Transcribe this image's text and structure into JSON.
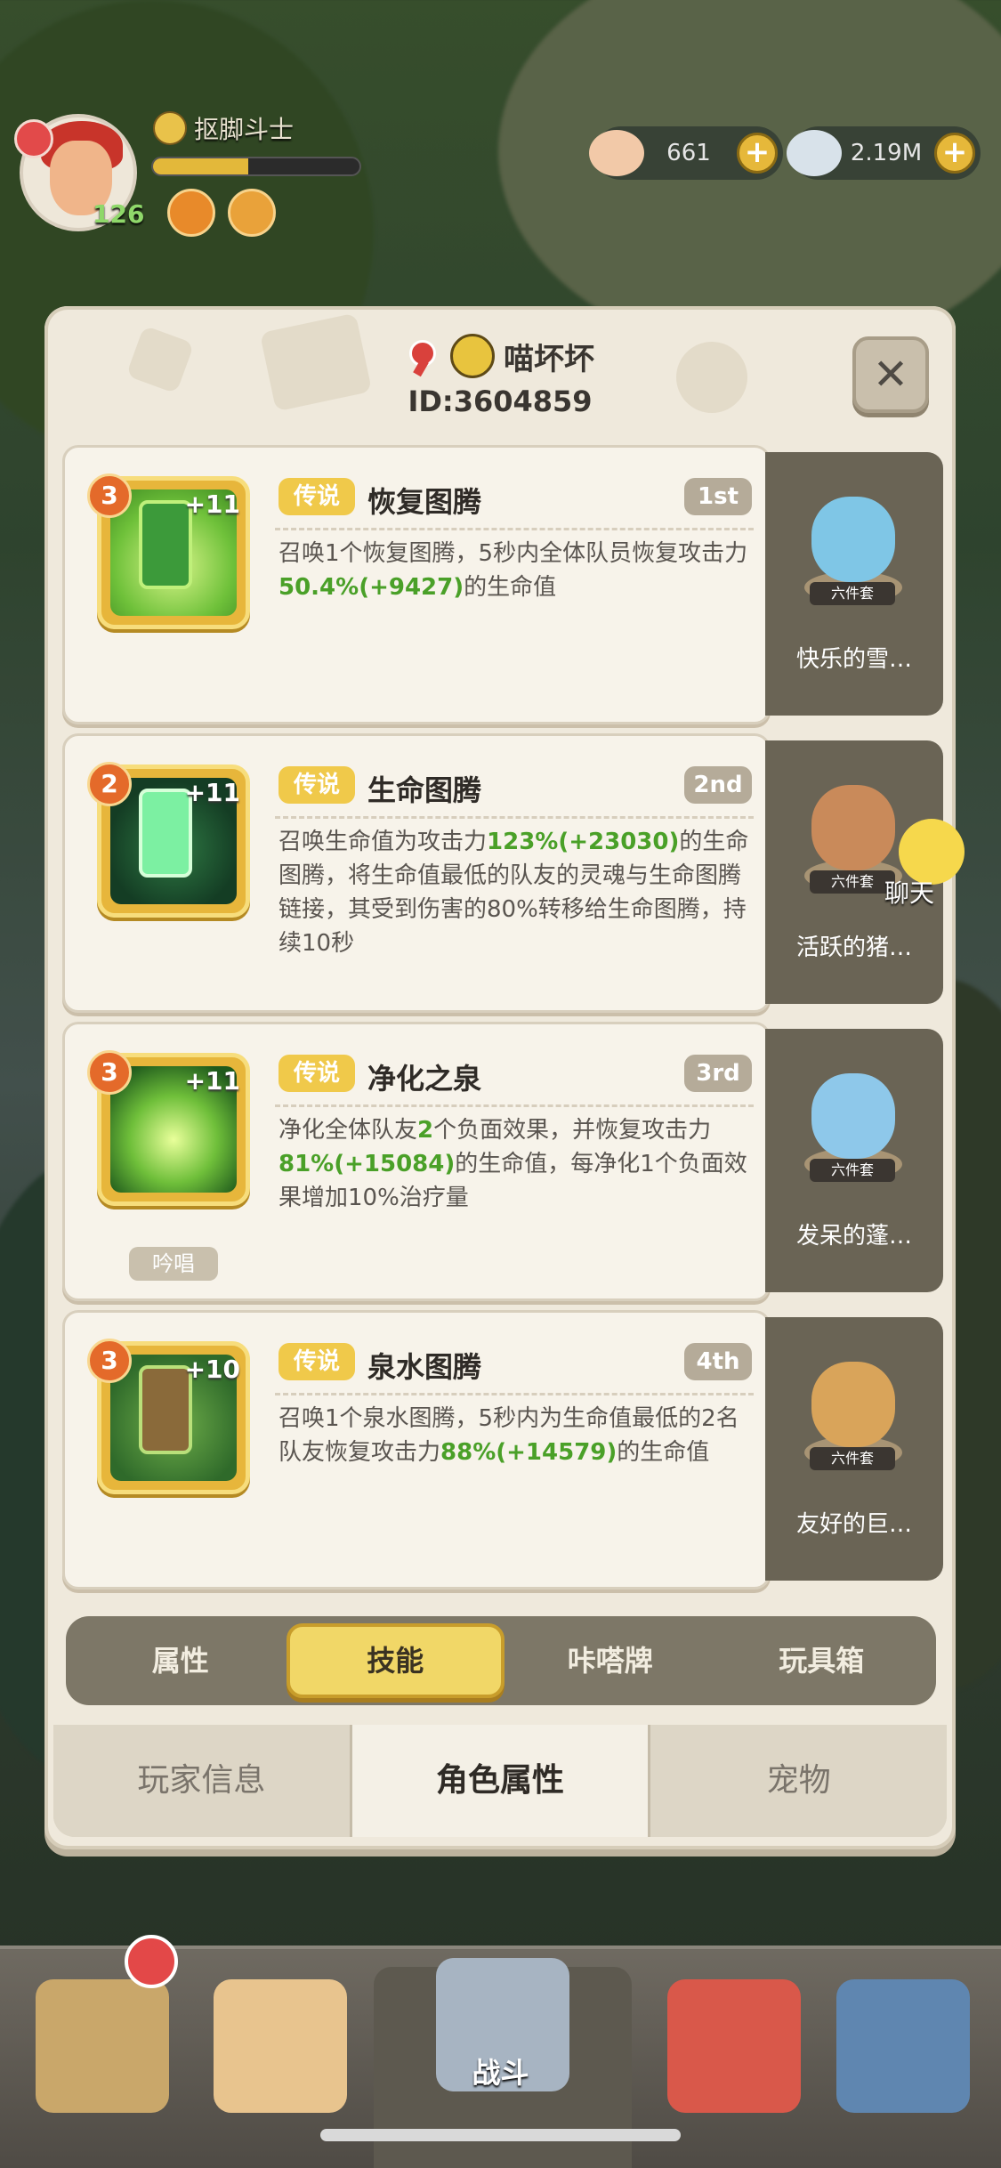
{
  "hud": {
    "player_title": "抠脚斗士",
    "level": "126",
    "xp_fraction": 0.46,
    "resources": [
      {
        "name": "shell",
        "value": "661"
      },
      {
        "name": "pearl",
        "value": "2.19M"
      }
    ],
    "plus_label": "+"
  },
  "profile": {
    "nickname": "喵坏坏",
    "id_text": "ID:3604859",
    "close_label": "✕"
  },
  "skills": [
    {
      "level": "3",
      "plus_level": "+11",
      "rarity": "传说",
      "name": "恢复图腾",
      "rank": "1st",
      "desc_parts": [
        "召唤1个恢复图腾，5秒内全体队员恢复攻击力",
        "50.4%(+9427)",
        "的生命值"
      ],
      "pet_tag": "六件套",
      "pet_name": "快乐的雪…",
      "chant": ""
    },
    {
      "level": "2",
      "plus_level": "+11",
      "rarity": "传说",
      "name": "生命图腾",
      "rank": "2nd",
      "desc_parts": [
        "召唤生命值为攻击力",
        "123%(+23030)",
        "的生命图腾，将生命值最低的队友的灵魂与生命图腾链接，其受到伤害的80%转移给生命图腾，持续10秒"
      ],
      "pet_tag": "六件套",
      "pet_name": "活跃的猪…",
      "chant": ""
    },
    {
      "level": "3",
      "plus_level": "+11",
      "rarity": "传说",
      "name": "净化之泉",
      "rank": "3rd",
      "desc_parts": [
        "净化全体队友",
        "2",
        "个负面效果，并恢复攻击力",
        "81%(+15084)",
        "的生命值，每净化1个负面效果增加10%治疗量"
      ],
      "pet_tag": "六件套",
      "pet_name": "发呆的蓬…",
      "chant": "吟唱"
    },
    {
      "level": "3",
      "plus_level": "+10",
      "rarity": "传说",
      "name": "泉水图腾",
      "rank": "4th",
      "desc_parts": [
        "召唤1个泉水图腾，5秒内为生命值最低的2名队友恢复攻击力",
        "88%(+14579)",
        "的生命值"
      ],
      "pet_tag": "六件套",
      "pet_name": "友好的巨…",
      "chant": ""
    }
  ],
  "chat": {
    "label": "聊天"
  },
  "subtabs": [
    "属性",
    "技能",
    "咔嗒牌",
    "玩具箱"
  ],
  "subtab_active": 1,
  "maintabs": [
    "玩家信息",
    "角色属性",
    "宠物"
  ],
  "maintab_active": 1,
  "bottom_nav": {
    "battle_label": "战斗"
  },
  "colors": {
    "accent_gold": "#f1d767",
    "highlight_green": "#4aa028",
    "rarity_gold": "#f0c94a"
  }
}
